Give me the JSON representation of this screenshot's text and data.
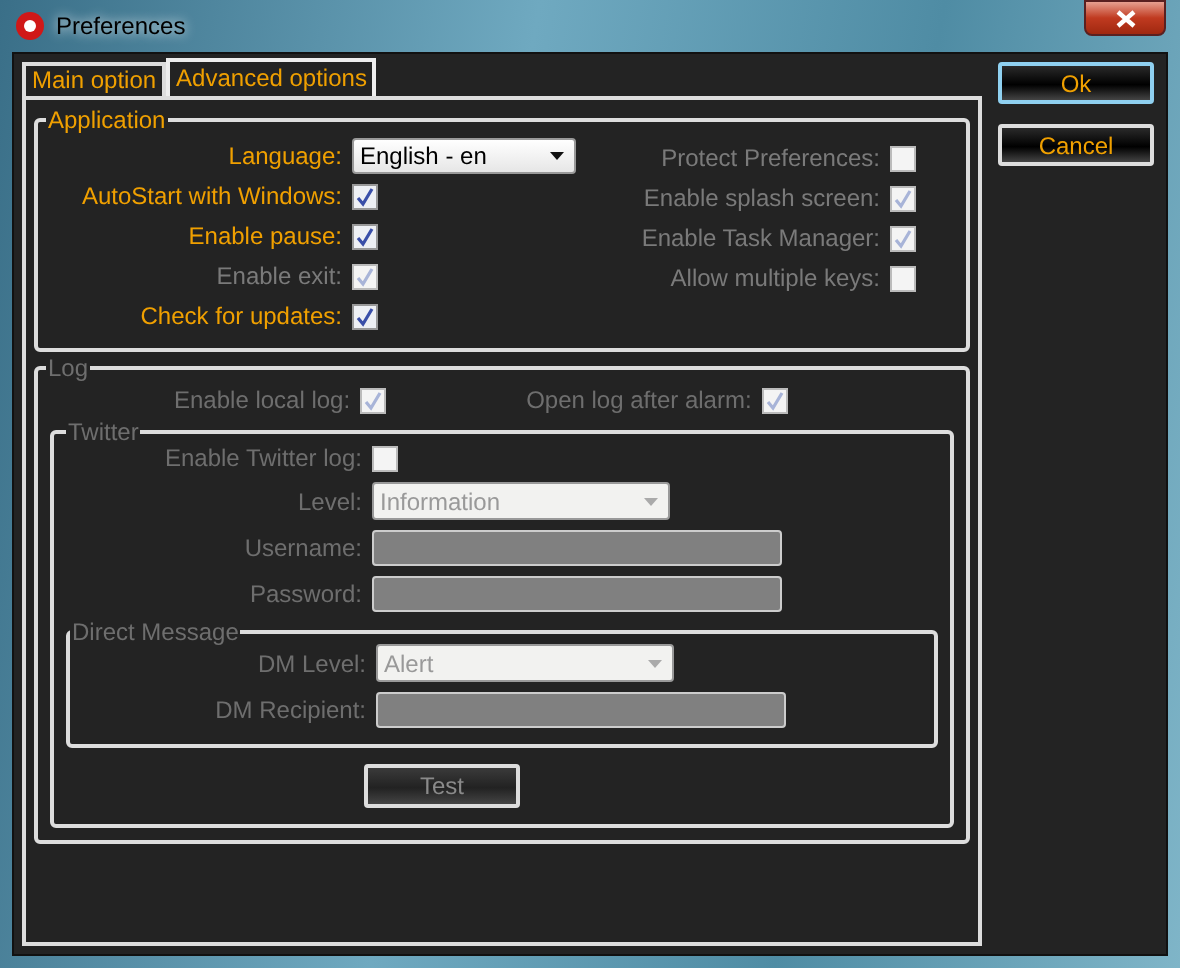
{
  "window": {
    "title": "Preferences"
  },
  "tabs": [
    {
      "label": "Main option",
      "selected": false
    },
    {
      "label": "Advanced options",
      "selected": true
    }
  ],
  "buttons": [
    {
      "label": "Ok",
      "focused": true
    },
    {
      "label": "Cancel",
      "focused": false
    }
  ],
  "application": {
    "title": "Application",
    "language": {
      "label": "Language:",
      "value": "English - en"
    },
    "left_options": [
      {
        "label": "AutoStart with Windows:",
        "checked": true,
        "disabled": false
      },
      {
        "label": "Enable pause:",
        "checked": true,
        "disabled": false
      },
      {
        "label": "Enable exit:",
        "checked": true,
        "disabled": true
      },
      {
        "label": "Check for updates:",
        "checked": true,
        "disabled": false
      }
    ],
    "right_options": [
      {
        "label": "Protect Preferences:",
        "checked": false,
        "disabled": true
      },
      {
        "label": "Enable splash screen:",
        "checked": true,
        "disabled": true
      },
      {
        "label": "Enable Task Manager:",
        "checked": true,
        "disabled": true
      },
      {
        "label": "Allow multiple keys:",
        "checked": false,
        "disabled": true
      }
    ]
  },
  "log": {
    "title": "Log",
    "options": [
      {
        "label": "Enable local log:",
        "checked": true,
        "disabled": true
      },
      {
        "label": "Open log after alarm:",
        "checked": true,
        "disabled": true
      }
    ],
    "twitter": {
      "title": "Twitter",
      "enable": {
        "label": "Enable Twitter log:",
        "checked": false,
        "disabled": true
      },
      "level": {
        "label": "Level:",
        "value": "Information"
      },
      "username": {
        "label": "Username:"
      },
      "password": {
        "label": "Password:"
      },
      "direct_message": {
        "title": "Direct Message",
        "dm_level": {
          "label": "DM Level:",
          "value": "Alert"
        },
        "dm_recipient": {
          "label": "DM Recipient:"
        }
      },
      "test_button": {
        "label": "Test"
      }
    }
  }
}
